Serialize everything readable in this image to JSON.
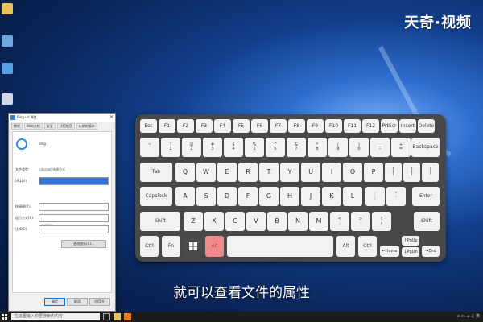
{
  "watermark": "天奇·视频",
  "subtitle": "就可以查看文件的属性",
  "dialog": {
    "title": "Bing.url 属性",
    "tabs": [
      "常规",
      "Web文档",
      "安全",
      "详细信息",
      "以前的版本"
    ],
    "name": "Bing",
    "rows": [
      {
        "label": "文件类型:",
        "value": "Internet 快捷方式"
      },
      {
        "label": "URL(U):",
        "value": "http://go.microsoft.com/fwlink/p/?LinkId=255142"
      },
      {
        "label": "快捷键(K):",
        "value": "无"
      },
      {
        "label": "运行方式(R):",
        "value": "常规窗口"
      },
      {
        "label": "注释(O):",
        "value": ""
      }
    ],
    "change_icon_label": "更改图标(C)...",
    "buttons": [
      "确定",
      "取消",
      "应用(A)"
    ]
  },
  "keyboard": {
    "row1": [
      "Esc",
      "F1",
      "F2",
      "F3",
      "F4",
      "F5",
      "F6",
      "F7",
      "F8",
      "F9",
      "F10",
      "F11",
      "F12",
      "PrtScr",
      "Insert",
      "Delete"
    ],
    "row2": [
      [
        "~",
        "`"
      ],
      [
        "!",
        "1"
      ],
      [
        "@",
        "2"
      ],
      [
        "#",
        "3"
      ],
      [
        "$",
        "4"
      ],
      [
        "%",
        "5"
      ],
      [
        "^",
        "6"
      ],
      [
        "&",
        "7"
      ],
      [
        "*",
        "8"
      ],
      [
        "(",
        "9"
      ],
      [
        ")",
        "0"
      ],
      [
        "_",
        "-"
      ],
      [
        "+",
        "="
      ]
    ],
    "backspace": "Backspace",
    "tab": "Tab",
    "row3": [
      "Q",
      "W",
      "E",
      "R",
      "T",
      "Y",
      "U",
      "I",
      "O",
      "P"
    ],
    "row3_sym": [
      [
        "{",
        "["
      ],
      [
        "}",
        "]"
      ],
      [
        "|",
        "\\"
      ]
    ],
    "capslock": "Capslock",
    "row4": [
      "A",
      "S",
      "D",
      "F",
      "G",
      "H",
      "J",
      "K",
      "L"
    ],
    "row4_sym": [
      [
        ":",
        ";"
      ],
      [
        "\"",
        "'"
      ]
    ],
    "enter": "Enter",
    "shift": "Shift",
    "row5": [
      "Z",
      "X",
      "C",
      "V",
      "B",
      "N",
      "M"
    ],
    "row5_sym": [
      [
        "<",
        ","
      ],
      [
        ">",
        "."
      ],
      [
        "?",
        "/"
      ]
    ],
    "ctrl": "Ctrl",
    "fn": "Fn",
    "alt_highlight": "Alt",
    "alt": "Alt",
    "pgup": "↑PgUp",
    "home": "←Home",
    "pgdn": "↓PgDn",
    "end": "→End"
  },
  "taskbar": {
    "search_placeholder": "在这里输入你要搜索的内容",
    "tray_text": "∧ ▭ ⊿ ♫ 英"
  }
}
